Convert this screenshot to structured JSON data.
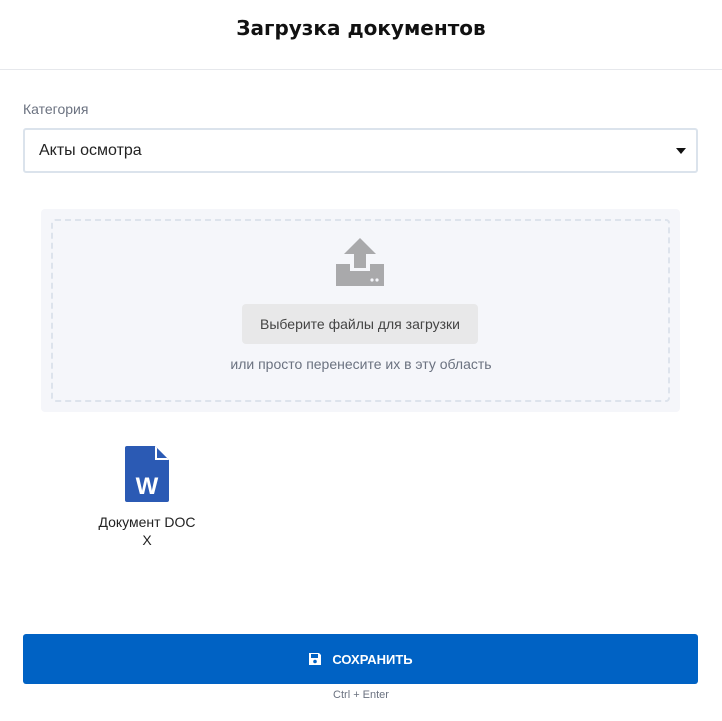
{
  "header": {
    "title": "Загрузка документов"
  },
  "category": {
    "label": "Категория",
    "value": "Акты осмотра"
  },
  "upload": {
    "button_label": "Выберите файлы для загрузки",
    "hint": "или просто перенесите их в эту область"
  },
  "files": [
    {
      "name": "Документ DOCX",
      "icon": "word-file-icon"
    }
  ],
  "footer": {
    "save_label": "СОХРАНИТЬ",
    "shortcut": "Ctrl + Enter"
  },
  "colors": {
    "accent": "#0062c4",
    "word": "#2b5ab4"
  }
}
